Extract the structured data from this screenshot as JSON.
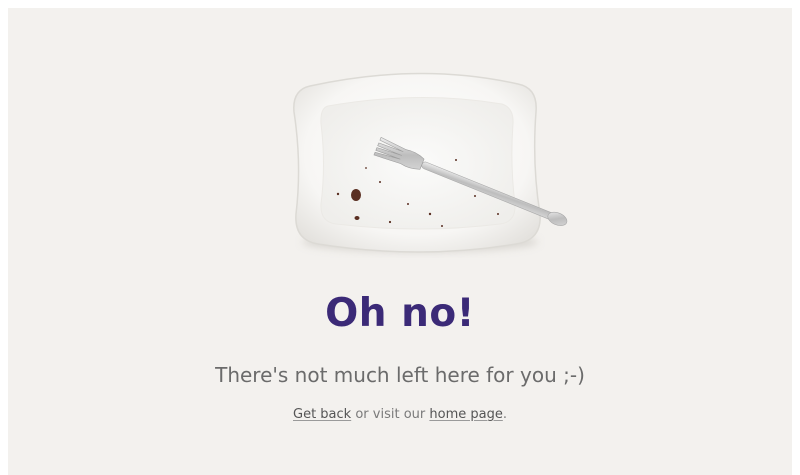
{
  "main": {
    "plate_image": "empty-plate-with-fork",
    "title": "Oh no!",
    "subtitle": "There's not much left here for you ;-)",
    "nav": {
      "get_back_link": "Get back",
      "middle_text": "or visit our",
      "home_page_link": "home page",
      "trailing_text": "."
    }
  },
  "colors": {
    "background": "#f3f1ee",
    "title": "#3b2a77",
    "subtitle": "#6b6b6b",
    "link": "#555555"
  }
}
